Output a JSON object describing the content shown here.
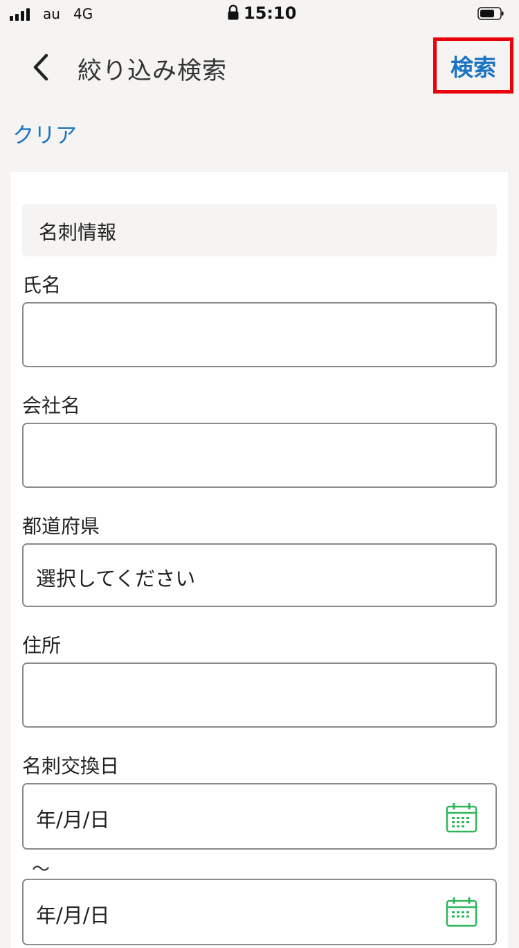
{
  "status_bar": {
    "carrier": "au",
    "network": "4G",
    "time": "15:10",
    "icons": [
      "signal-icon",
      "lock-icon",
      "battery-icon"
    ]
  },
  "header": {
    "back_icon": "chevron-left-icon",
    "title": "絞り込み検索",
    "search_label": "検索",
    "highlight_color": "#e8000b"
  },
  "clear_label": "クリア",
  "form": {
    "section_title": "名刺情報",
    "name": {
      "label": "氏名",
      "value": ""
    },
    "company": {
      "label": "会社名",
      "value": ""
    },
    "prefecture": {
      "label": "都道府県",
      "value": "選択してください"
    },
    "address": {
      "label": "住所",
      "value": ""
    },
    "exchange_date": {
      "label": "名刺交換日",
      "from_value": "年/月/日",
      "separator": "～",
      "to_value": "年/月/日",
      "icon": "calendar-icon"
    }
  },
  "colors": {
    "accent": "#1a74c4",
    "background": "#f5f4f2",
    "calendar": "#2fb65a"
  }
}
